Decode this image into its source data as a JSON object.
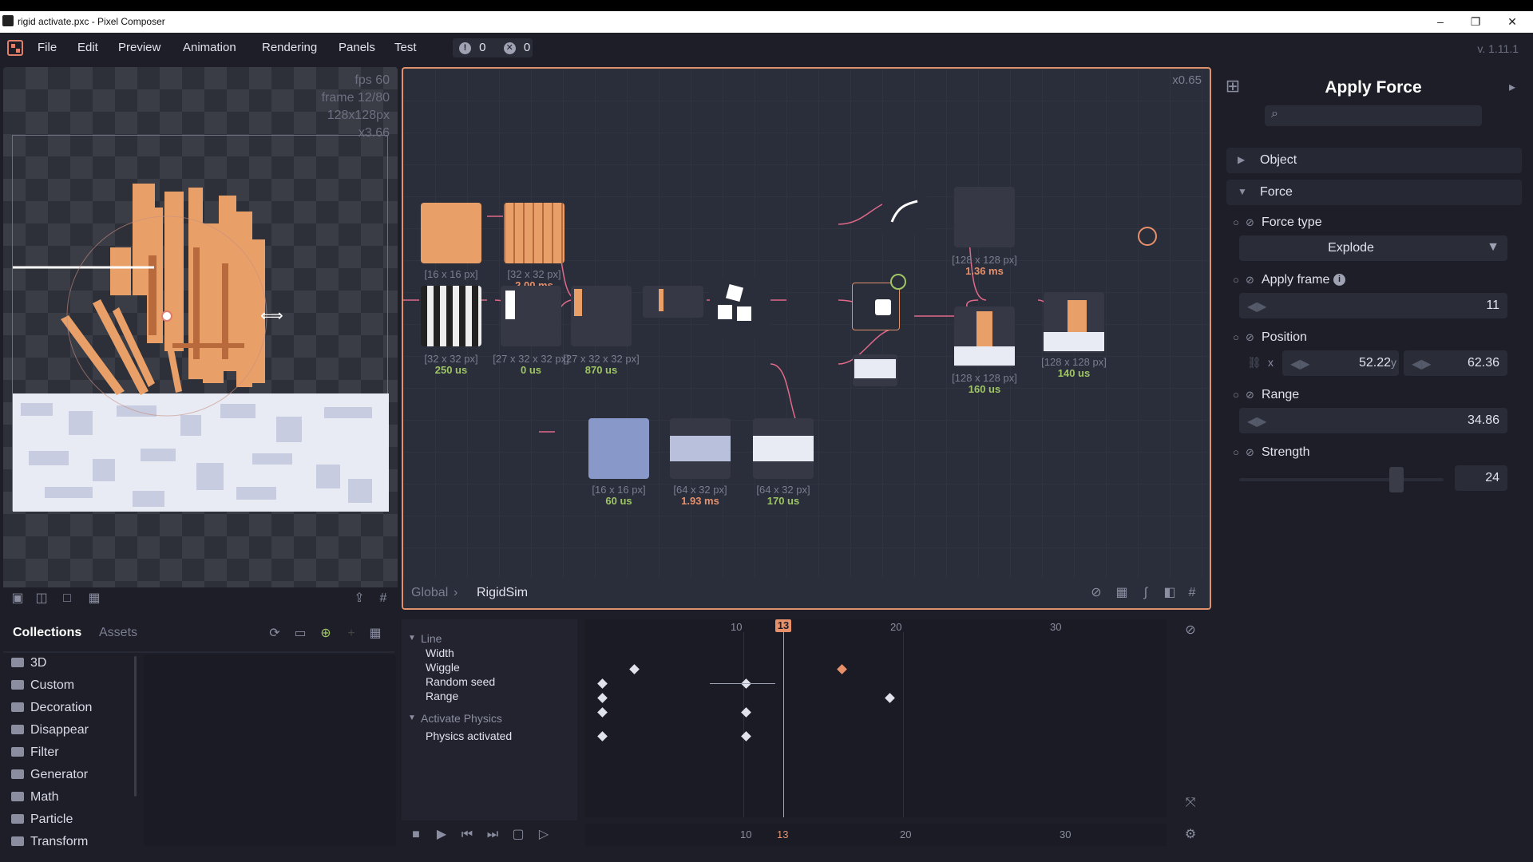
{
  "window": {
    "title": "rigid activate.pxc - Pixel Composer",
    "controls": [
      "–",
      "❐",
      "✕"
    ]
  },
  "menubar": {
    "items": [
      "File",
      "Edit",
      "Preview",
      "Animation",
      "Rendering",
      "Panels",
      "Test"
    ],
    "warnings": "0",
    "errors": "0",
    "version": "v. 1.11.1"
  },
  "preview": {
    "fps": "fps 60",
    "frame": "frame 12/80",
    "size": "128x128px",
    "zoom": "x3.66"
  },
  "graph": {
    "zoom": "x0.65",
    "breadcrumb": [
      "Global",
      "RigidSim"
    ],
    "nodes": [
      {
        "size": "[16 x 16 px]",
        "time": ""
      },
      {
        "size": "[32 x 32 px]",
        "time": "2.00 ms"
      },
      {
        "size": "[32 x 32 px]",
        "time": "250 us"
      },
      {
        "size": "[27 x 32 x 32 px]",
        "time": "0 us"
      },
      {
        "size": "[27 x 32 x 32 px]",
        "time": "870 us"
      },
      {
        "size": "[128 x 128 px]",
        "time": "1.36 ms"
      },
      {
        "size": "[128 x 128 px]",
        "time": "160 us"
      },
      {
        "size": "[128 x 128 px]",
        "time": "140 us"
      },
      {
        "size": "[16 x 16 px]",
        "time": "60 us"
      },
      {
        "size": "[64 x 32 px]",
        "time": "1.93 ms"
      },
      {
        "size": "[64 x 32 px]",
        "time": "170 us"
      }
    ]
  },
  "inspector": {
    "title": "Apply Force",
    "search_placeholder": "",
    "sections": {
      "object": "Object",
      "force": "Force"
    },
    "force_type_label": "Force type",
    "force_type_value": "Explode",
    "apply_frame_label": "Apply frame",
    "apply_frame_value": "11",
    "position_label": "Position",
    "pos_x_label": "x",
    "pos_x": "52.22",
    "pos_y_label": "y",
    "pos_y": "62.36",
    "range_label": "Range",
    "range_value": "34.86",
    "strength_label": "Strength",
    "strength_value": "24",
    "strength_fraction": 0.77
  },
  "collections": {
    "tabs": [
      "Collections",
      "Assets"
    ],
    "folders": [
      "3D",
      "Custom",
      "Decoration",
      "Disappear",
      "Filter",
      "Generator",
      "Math",
      "Particle",
      "Transform"
    ]
  },
  "timeline": {
    "groups": [
      "Line",
      "Activate Physics"
    ],
    "rows": [
      "Width",
      "Wiggle",
      "Random seed",
      "Range",
      "Physics activated"
    ],
    "current_frame": "13",
    "ticks": [
      "10",
      "20",
      "30"
    ],
    "bottom_ticks": [
      "10",
      "13",
      "20",
      "30"
    ]
  },
  "colors": {
    "accent": "#e0906a",
    "green": "#9ec564",
    "panel": "#1d1e28"
  }
}
